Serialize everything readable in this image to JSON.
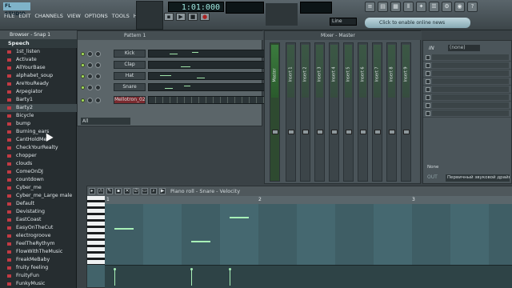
{
  "app": {
    "logo": "FL STUDIO",
    "accent": "#a8f0b7",
    "brand_color": "#7fb3c9"
  },
  "menu": [
    "FILE",
    "EDIT",
    "CHANNELS",
    "VIEW",
    "OPTIONS",
    "TOOLS",
    "HELP"
  ],
  "transport": {
    "time": "1:01:000",
    "buttons": [
      "pattern",
      "play",
      "stop",
      "record"
    ],
    "line_mode": "Line",
    "online_text": "Click to enable online news"
  },
  "browser": {
    "title": "Browser - Snap 1",
    "folder": "Speech",
    "items": [
      "1st_listen",
      "Activate",
      "AllYourBase",
      "alphabet_soup",
      "AreYouReady",
      "Arpegiator",
      "Barty1",
      "Barty2",
      "Bicycle",
      "bump",
      "Burning_ears",
      "CantHoldMe",
      "CheckYourRealty",
      "chopper",
      "clouds",
      "ComeOnDJ",
      "countdown",
      "Cyber_me",
      "Cyber_me_Large male",
      "Default",
      "Devistating",
      "EastCoast",
      "EasyOnTheCut",
      "electrogroove",
      "FeelTheRythym",
      "FlowWithTheMusic",
      "FreakMeBaby",
      "fruity feeling",
      "FruityFun",
      "FunkyMusic"
    ],
    "selected_index": 7
  },
  "channel_rack": {
    "title": "Pattern 1",
    "filter": "All",
    "channels": [
      {
        "name": "Kick"
      },
      {
        "name": "Clap"
      },
      {
        "name": "Hat"
      },
      {
        "name": "Snare"
      },
      {
        "name": "Mellotron_02"
      }
    ]
  },
  "mixer": {
    "title": "Mixer - Master",
    "tracks": [
      "Master",
      "Insert 1",
      "Insert 2",
      "Insert 3",
      "Insert 4",
      "Insert 5",
      "Insert 6",
      "Insert 7",
      "Insert 8",
      "Insert 9"
    ],
    "insert_slot": "(none)",
    "input_label": "IN",
    "output_label": "OUT",
    "none_label": "None",
    "output_device": "Первичный звуковой драйвер"
  },
  "piano_roll": {
    "title": "Piano roll - Snare - Velocity",
    "ruler": [
      "1",
      "2",
      "3"
    ],
    "velocity_level": 0.75
  }
}
